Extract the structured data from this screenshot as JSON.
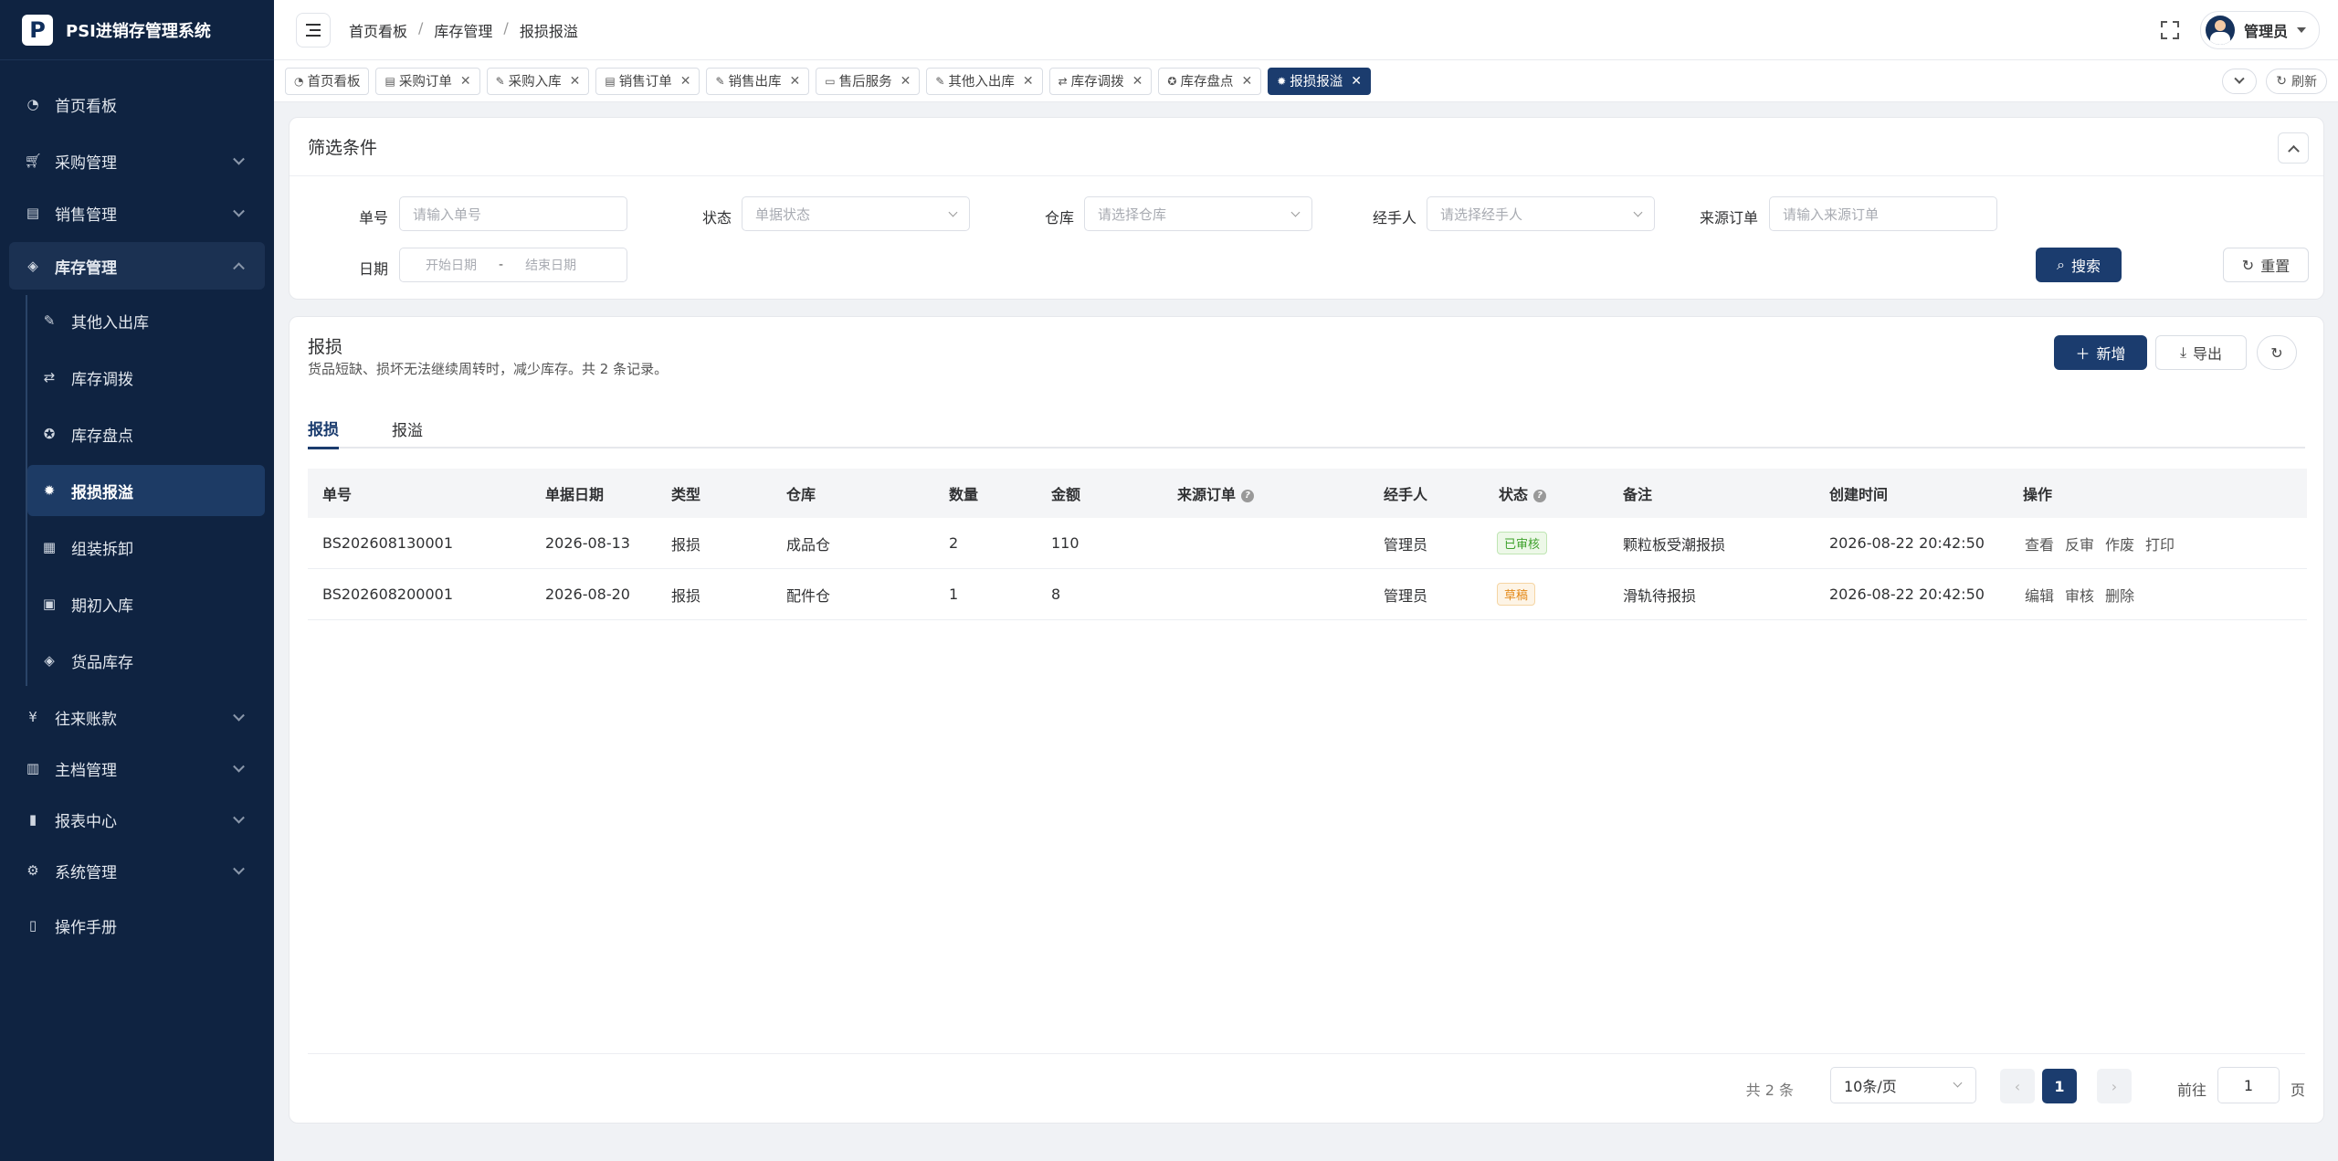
{
  "app": {
    "logo_letter": "P",
    "title": "PSI进销存管理系统"
  },
  "sidebar": {
    "items": [
      {
        "label": "首页看板"
      },
      {
        "label": "采购管理"
      },
      {
        "label": "销售管理"
      },
      {
        "label": "库存管理"
      },
      {
        "label": "往来账款"
      },
      {
        "label": "主档管理"
      },
      {
        "label": "报表中心"
      },
      {
        "label": "系统管理"
      },
      {
        "label": "操作手册"
      }
    ],
    "inventory_sub": [
      {
        "label": "其他入出库"
      },
      {
        "label": "库存调拨"
      },
      {
        "label": "库存盘点"
      },
      {
        "label": "报损报溢"
      },
      {
        "label": "组装拆卸"
      },
      {
        "label": "期初入库"
      },
      {
        "label": "货品库存"
      }
    ]
  },
  "breadcrumb": [
    "首页看板",
    "库存管理",
    "报损报溢"
  ],
  "user": {
    "name": "管理员"
  },
  "tabs": [
    {
      "label": "首页看板"
    },
    {
      "label": "采购订单"
    },
    {
      "label": "采购入库"
    },
    {
      "label": "销售订单"
    },
    {
      "label": "销售出库"
    },
    {
      "label": "售后服务"
    },
    {
      "label": "其他入出库"
    },
    {
      "label": "库存调拨"
    },
    {
      "label": "库存盘点"
    },
    {
      "label": "报损报溢"
    }
  ],
  "tabs_refresh": "刷新",
  "filter": {
    "title": "筛选条件",
    "order_no_label": "单号",
    "order_no_placeholder": "请输入单号",
    "status_label": "状态",
    "status_placeholder": "单据状态",
    "warehouse_label": "仓库",
    "warehouse_placeholder": "请选择仓库",
    "handler_label": "经手人",
    "handler_placeholder": "请选择经手人",
    "source_label": "来源订单",
    "source_placeholder": "请输入来源订单",
    "date_label": "日期",
    "start_placeholder": "开始日期",
    "date_sep": "-",
    "end_placeholder": "结束日期",
    "search": "搜索",
    "reset": "重置"
  },
  "list": {
    "title": "报损",
    "desc": "货品短缺、损坏无法继续周转时，减少库存。共 2 条记录。",
    "add": "新增",
    "export": "导出",
    "inner_tabs": [
      "报损",
      "报溢"
    ],
    "columns": [
      "单号",
      "单据日期",
      "类型",
      "仓库",
      "数量",
      "金额",
      "来源订单",
      "经手人",
      "状态",
      "备注",
      "创建时间",
      "操作"
    ],
    "rows": [
      {
        "no": "BS202608130001",
        "date": "2026-08-13",
        "type": "报损",
        "warehouse": "成品仓",
        "qty": "2",
        "amount": "110",
        "source": "",
        "handler": "管理员",
        "status": "已审核",
        "remark": "颗粒板受潮报损",
        "created": "2026-08-22 20:42:50",
        "ops": [
          "查看",
          "反审",
          "作废",
          "打印"
        ]
      },
      {
        "no": "BS202608200001",
        "date": "2026-08-20",
        "type": "报损",
        "warehouse": "配件仓",
        "qty": "1",
        "amount": "8",
        "source": "",
        "handler": "管理员",
        "status": "草稿",
        "remark": "滑轨待报损",
        "created": "2026-08-22 20:42:50",
        "ops": [
          "编辑",
          "审核",
          "删除"
        ]
      }
    ]
  },
  "pager": {
    "total": "共 2 条",
    "page_size": "10条/页",
    "current": "1",
    "goto_label": "前往",
    "goto_value": "1",
    "page_suffix": "页"
  }
}
